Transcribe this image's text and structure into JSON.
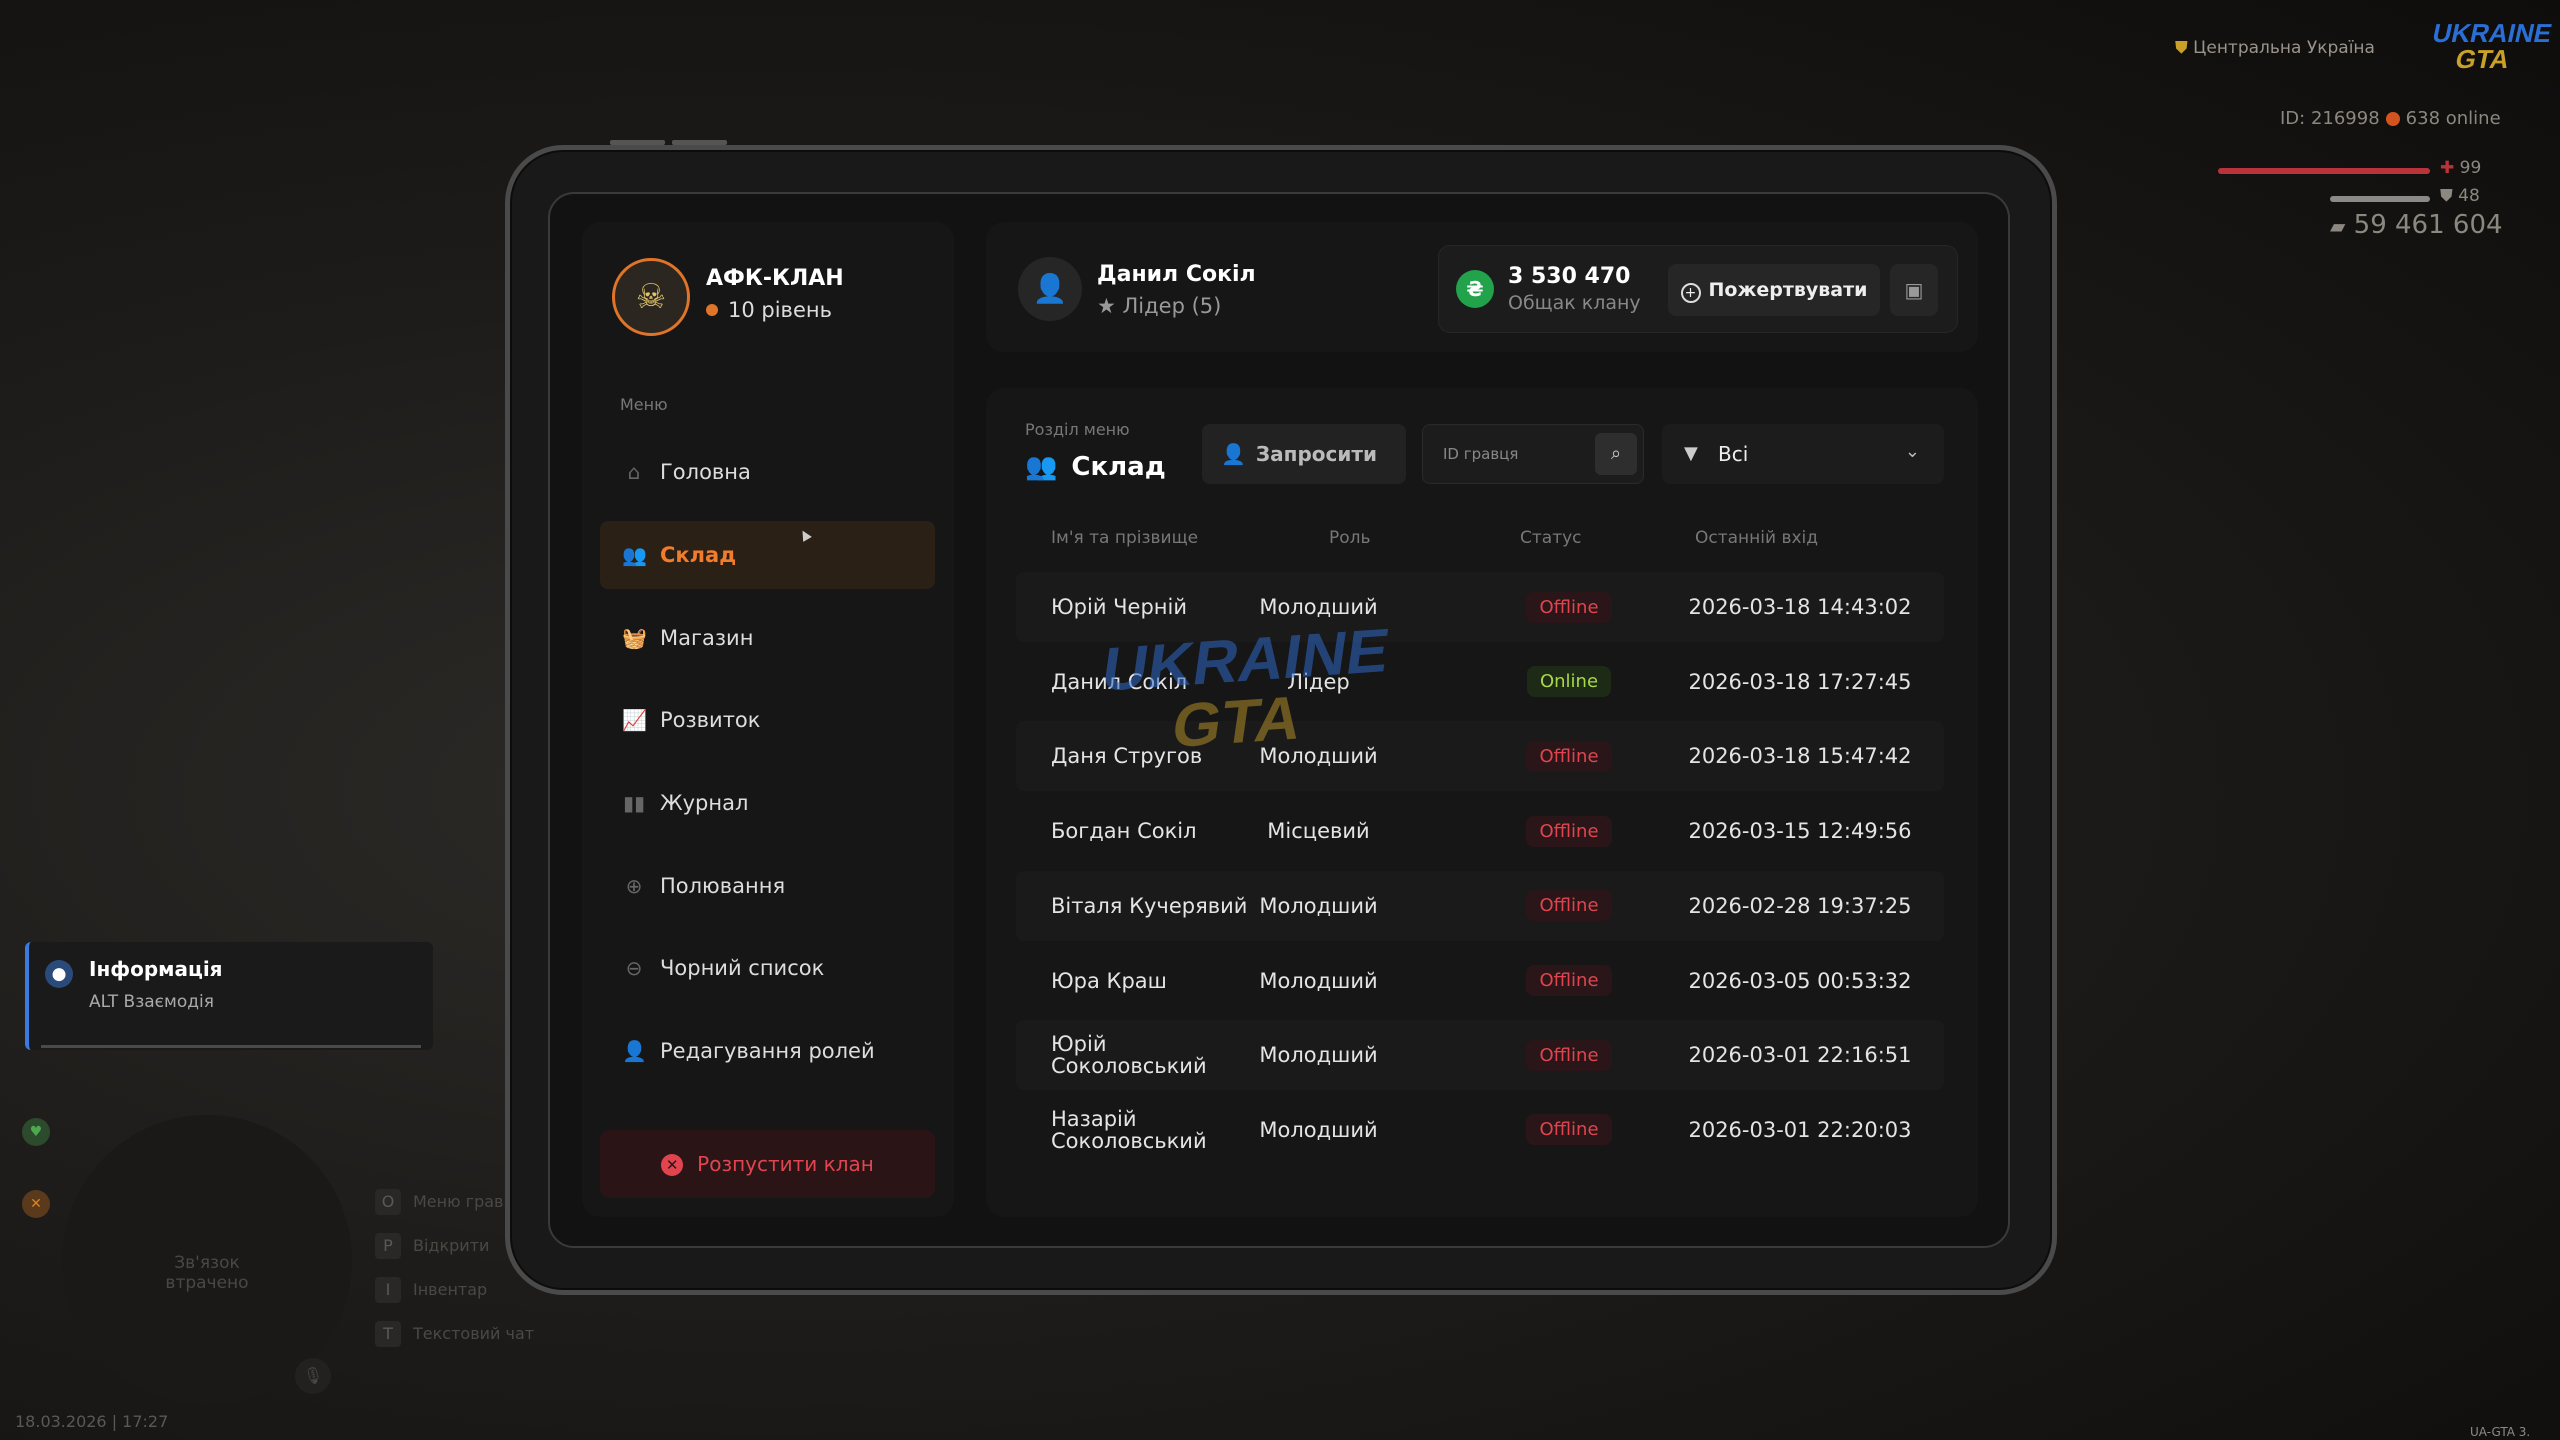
{
  "hud": {
    "location": "Центральна Україна",
    "logo_top": "UKRAINE",
    "logo_bottom": "GTA",
    "id_text": "ID: 216998",
    "online_text": "638 online",
    "health": "99",
    "armor": "48",
    "money": "59 461 604"
  },
  "info": {
    "title": "Інформація",
    "subtitle": "ALT Взаємодія"
  },
  "radar": {
    "text_line1": "Зв'язок",
    "text_line2": "втрачено"
  },
  "hints": [
    {
      "key": "O",
      "label": "Меню гравця"
    },
    {
      "key": "P",
      "label": "Відкрити"
    },
    {
      "key": "I",
      "label": "Інвентар"
    },
    {
      "key": "T",
      "label": "Текстовий чат"
    }
  ],
  "datetime": "18.03.2026 | 17:27",
  "version": "UA-GTA 3.",
  "clan": {
    "name": "АФК-КЛАН",
    "level": "10 рівень"
  },
  "menu_label": "Меню",
  "menu": [
    {
      "label": "Головна",
      "icon": "home-icon"
    },
    {
      "label": "Склад",
      "icon": "members-icon"
    },
    {
      "label": "Магазин",
      "icon": "shop-icon"
    },
    {
      "label": "Розвиток",
      "icon": "chart-icon"
    },
    {
      "label": "Журнал",
      "icon": "journal-icon"
    },
    {
      "label": "Полювання",
      "icon": "target-icon"
    },
    {
      "label": "Чорний список",
      "icon": "block-icon"
    },
    {
      "label": "Редагування ролей",
      "icon": "role-edit-icon"
    }
  ],
  "disband_label": "Розпустити клан",
  "user": {
    "name": "Данил Сокіл",
    "role": "Лідер (5)"
  },
  "bank": {
    "value": "3 530 470",
    "label": "Общак клану",
    "donate_label": "Пожертвувати"
  },
  "section": {
    "label": "Розділ меню",
    "title": "Склад"
  },
  "invite_label": "Запросити",
  "search_placeholder": "ID гравця",
  "filter_value": "Всі",
  "columns": {
    "name": "Ім'я та прізвище",
    "role": "Роль",
    "status": "Статус",
    "last": "Останній вхід"
  },
  "members": [
    {
      "name": "Юрій Черній",
      "role": "Молодший",
      "status": "Offline",
      "last": "2026-03-18 14:43:02"
    },
    {
      "name": "Данил Сокіл",
      "role": "Лідер",
      "status": "Online",
      "last": "2026-03-18 17:27:45"
    },
    {
      "name": "Даня Стругов",
      "role": "Молодший",
      "status": "Offline",
      "last": "2026-03-18 15:47:42"
    },
    {
      "name": "Богдан Сокіл",
      "role": "Місцевий",
      "status": "Offline",
      "last": "2026-03-15 12:49:56"
    },
    {
      "name": "Віталя Кучерявий",
      "role": "Молодший",
      "status": "Offline",
      "last": "2026-02-28 19:37:25"
    },
    {
      "name": "Юра Краш",
      "role": "Молодший",
      "status": "Offline",
      "last": "2026-03-05 00:53:32"
    },
    {
      "name": "Юрій Соколовський",
      "role": "Молодший",
      "status": "Offline",
      "last": "2026-03-01 22:16:51"
    },
    {
      "name": "Назарій Соколовський",
      "role": "Молодший",
      "status": "Offline",
      "last": "2026-03-01 22:20:03"
    }
  ],
  "watermark": {
    "top": "UKRAINE",
    "bottom": "GTA"
  },
  "colors": {
    "accent": "#f07c2c",
    "offline": "#e0454f",
    "online": "#a8d84a",
    "coin": "#22a24a"
  }
}
